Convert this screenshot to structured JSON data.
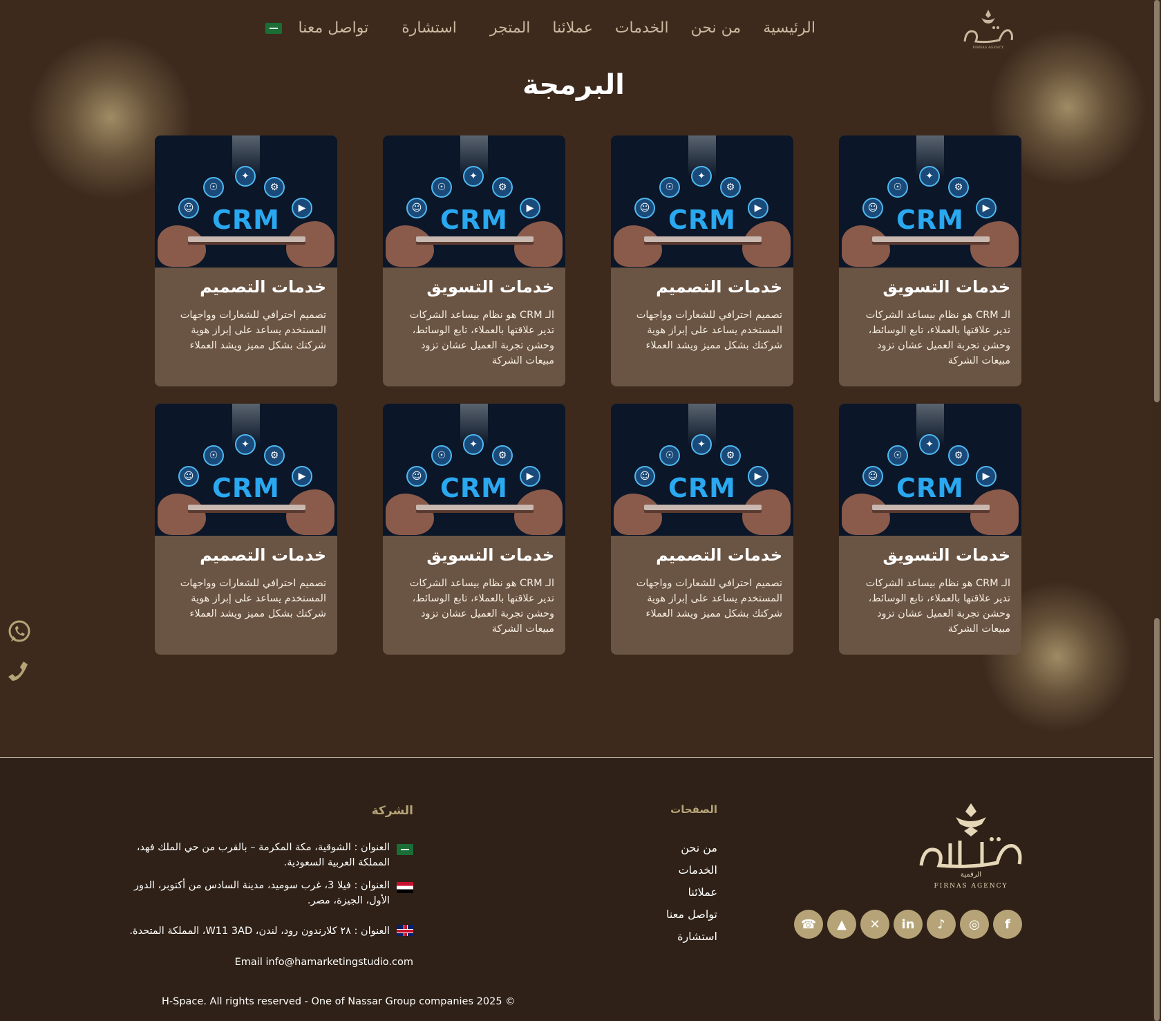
{
  "nav": {
    "items": [
      {
        "label": "الرئيسية"
      },
      {
        "label": "من نحن"
      },
      {
        "label": "الخدمات"
      },
      {
        "label": "عملائنا"
      },
      {
        "label": "المتجر"
      },
      {
        "label": "استشارة"
      },
      {
        "label": "تواصل معنا"
      }
    ],
    "logo_text": "فرناس",
    "logo_sub": "FIRNAS AGENCY"
  },
  "page": {
    "title": "البرمجة"
  },
  "cards": [
    {
      "image_label": "CRM",
      "title": "خدمات التسويق",
      "desc": "الـ CRM هو نظام بيساعد الشركات تدير علاقتها بالعملاء، تابع الوسائط، وحشن تجربة العميل عشان تزود مبيعات الشركة"
    },
    {
      "image_label": "CRM",
      "title": "خدمات التصميم",
      "desc": "تصميم احترافي للشعارات وواجهات المستخدم يساعد على إبراز هوية شركتك بشكل مميز ويشد العملاء"
    },
    {
      "image_label": "CRM",
      "title": "خدمات التسويق",
      "desc": "الـ CRM هو نظام بيساعد الشركات تدير علاقتها بالعملاء، تابع الوسائط، وحشن تجربة العميل عشان تزود مبيعات الشركة"
    },
    {
      "image_label": "CRM",
      "title": "خدمات التصميم",
      "desc": "تصميم احترافي للشعارات وواجهات المستخدم يساعد على إبراز هوية شركتك بشكل مميز ويشد العملاء"
    },
    {
      "image_label": "CRM",
      "title": "خدمات التسويق",
      "desc": "الـ CRM هو نظام بيساعد الشركات تدير علاقتها بالعملاء، تابع الوسائط، وحشن تجربة العميل عشان تزود مبيعات الشركة"
    },
    {
      "image_label": "CRM",
      "title": "خدمات التصميم",
      "desc": "تصميم احترافي للشعارات وواجهات المستخدم يساعد على إبراز هوية شركتك بشكل مميز ويشد العملاء"
    },
    {
      "image_label": "CRM",
      "title": "خدمات التسويق",
      "desc": "الـ CRM هو نظام بيساعد الشركات تدير علاقتها بالعملاء، تابع الوسائط، وحشن تجربة العميل عشان تزود مبيعات الشركة"
    },
    {
      "image_label": "CRM",
      "title": "خدمات التصميم",
      "desc": "تصميم احترافي للشعارات وواجهات المستخدم يساعد على إبراز هوية شركتك بشكل مميز ويشد العملاء"
    }
  ],
  "side": {
    "whatsapp_icon": "whatsapp-icon",
    "phone_icon": "phone-icon"
  },
  "footer": {
    "logo_text": "فرناس",
    "logo_sub_ar": "الرقمية",
    "logo_sub": "FIRNAS AGENCY",
    "pages_head": "الصفحات",
    "pages": [
      "من نحن",
      "الخدمات",
      "عملائنا",
      "تواصل معنا",
      "استشارة"
    ],
    "company_head": "الشركة",
    "addresses": [
      {
        "flag": "saudi-arabia",
        "text": "العنوان : الشوقية، مكة المكرمة – بالقرب من حي الملك فهد، المملكة العربية السعودية."
      },
      {
        "flag": "egypt",
        "text": "العنوان : فيلا 3، غرب سوميد، مدينة السادس من أكتوبر، الدور الأول، الجيزة، مصر."
      },
      {
        "flag": "united-kingdom",
        "text": "العنوان : ٢٨ كلارندون رود، لندن، W11 3AD، المملكة المتحدة."
      }
    ],
    "email": "Email info@hamarketingstudio.com",
    "copyright": "H-Space. All rights reserved - One of Nassar Group companies 2025 ©",
    "socials": [
      "facebook-icon",
      "instagram-icon",
      "tiktok-icon",
      "linkedin-icon",
      "x-icon",
      "snapchat-icon",
      "whatsapp-icon"
    ]
  },
  "colors": {
    "background": "#3d2a1d",
    "card": "#6a5443",
    "accent": "#b6a478",
    "footer": "#2f2117"
  }
}
